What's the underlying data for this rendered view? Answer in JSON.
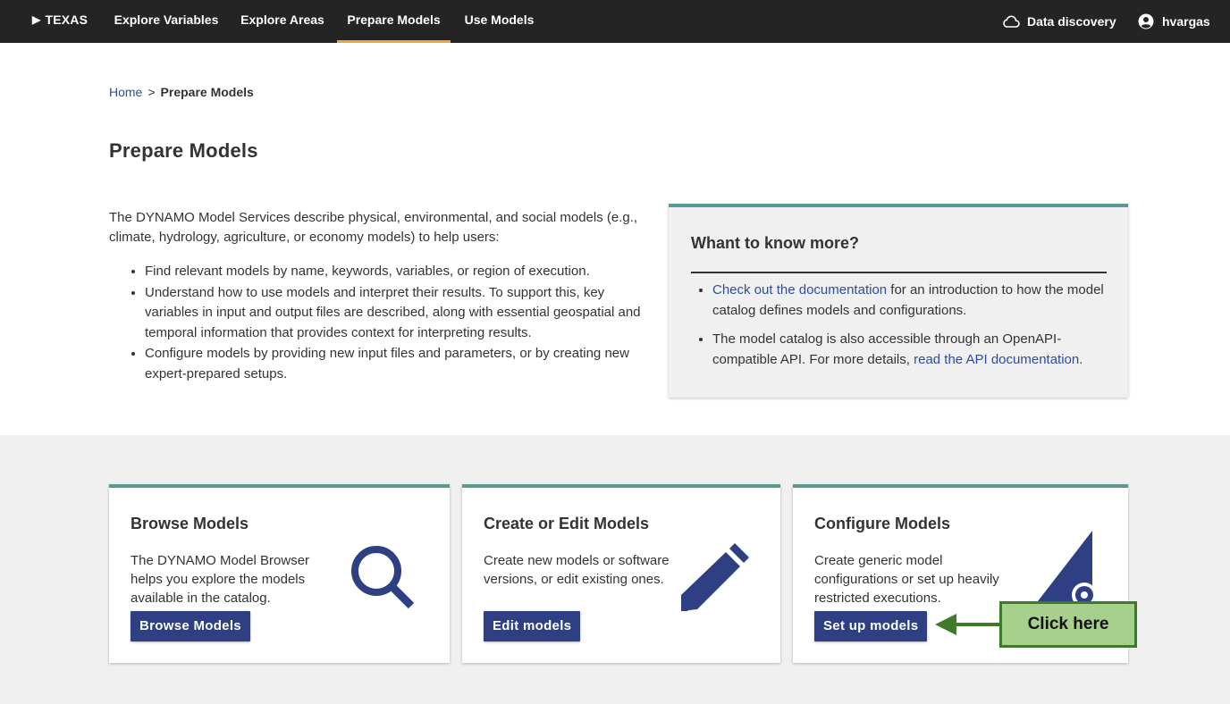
{
  "nav": {
    "brand": "TEXAS",
    "links": [
      "Explore Variables",
      "Explore Areas",
      "Prepare Models",
      "Use Models"
    ],
    "active": "Prepare Models",
    "data_discovery": "Data discovery",
    "user": "hvargas"
  },
  "breadcrumb": {
    "home": "Home",
    "separator": ">",
    "current": "Prepare Models"
  },
  "page": {
    "title": "Prepare Models",
    "intro": "The DYNAMO Model Services describe physical, environmental, and social models (e.g., climate, hydrology, agriculture, or economy models) to help users:",
    "bullets": [
      "Find relevant models by name, keywords, variables, or region of execution.",
      "Understand how to use models and interpret their results. To support this, key variables in input and output files are described, along with essential geospatial and temporal information that provides context for interpreting results.",
      "Configure models by providing new input files and parameters, or by creating new expert-prepared setups."
    ]
  },
  "info": {
    "title": "Whant to know more?",
    "item1_link": "Check out the documentation",
    "item1_text": " for an introduction to how the model catalog defines models and configurations.",
    "item2_text": "The model catalog is also accessible through an OpenAPI-compatible API. For more details, ",
    "item2_link": "read the API documentation."
  },
  "cards": [
    {
      "title": "Browse Models",
      "text": "The DYNAMO Model Browser helps you explore the models available in the catalog.",
      "button": "Browse Models",
      "icon": "search-icon"
    },
    {
      "title": "Create or Edit Models",
      "text": "Create new models or software versions, or edit existing ones.",
      "button": "Edit models",
      "icon": "pencil-icon"
    },
    {
      "title": "Configure Models",
      "text": "Create generic model configurations or set up heavily restricted executions.",
      "button": "Set up models",
      "icon": "set-square-gear-icon"
    }
  ],
  "annotation": {
    "label": "Click here"
  },
  "colors": {
    "nav_bg": "#242424",
    "active_underline": "#f0a545",
    "accent_border": "#5b9a92",
    "button": "#2e3f83",
    "link": "#2e4d9a",
    "callout_fill": "#a8d08d",
    "callout_border": "#3e7a2a"
  }
}
